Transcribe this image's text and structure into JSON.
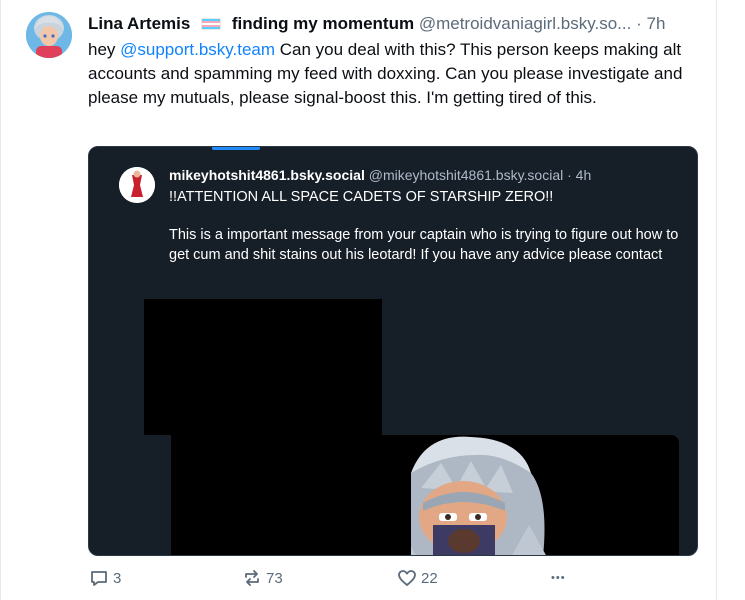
{
  "post": {
    "author": {
      "display_name": "Lina Artemis",
      "suffix": "finding my momentum",
      "handle": "@metroidvaniagirl.bsky.so...",
      "separator": "·",
      "time": "7h"
    },
    "text": {
      "prefix": "hey ",
      "mention": "@support.bsky.team",
      "body": " Can you deal with this?  This person keeps making alt accounts and spamming my feed with doxxing.  Can you please investigate and please my mutuals, please signal-boost this.  I'm getting tired of this."
    }
  },
  "quoted_post": {
    "author": {
      "display_name": "mikeyhotshit4861.bsky.social",
      "handle": "@mikeyhotshit4861.bsky.social",
      "separator": "·",
      "time": "4h"
    },
    "line1": "!!ATTENTION ALL SPACE CADETS OF STARSHIP ZERO!!",
    "line2": "This is a important message from your captain who is trying to figure out how to get cum and shit stains out his leotard! If you have any advice please contact"
  },
  "actions": {
    "reply_count": "3",
    "repost_count": "73",
    "like_count": "22",
    "more_label": "•••"
  },
  "colors": {
    "link": "#1083fe",
    "meta_text": "#5b6b7a",
    "embed_bg": "#161e27",
    "redaction": "#000000"
  },
  "icons": [
    "reply-icon",
    "repost-icon",
    "like-icon",
    "more-icon"
  ]
}
